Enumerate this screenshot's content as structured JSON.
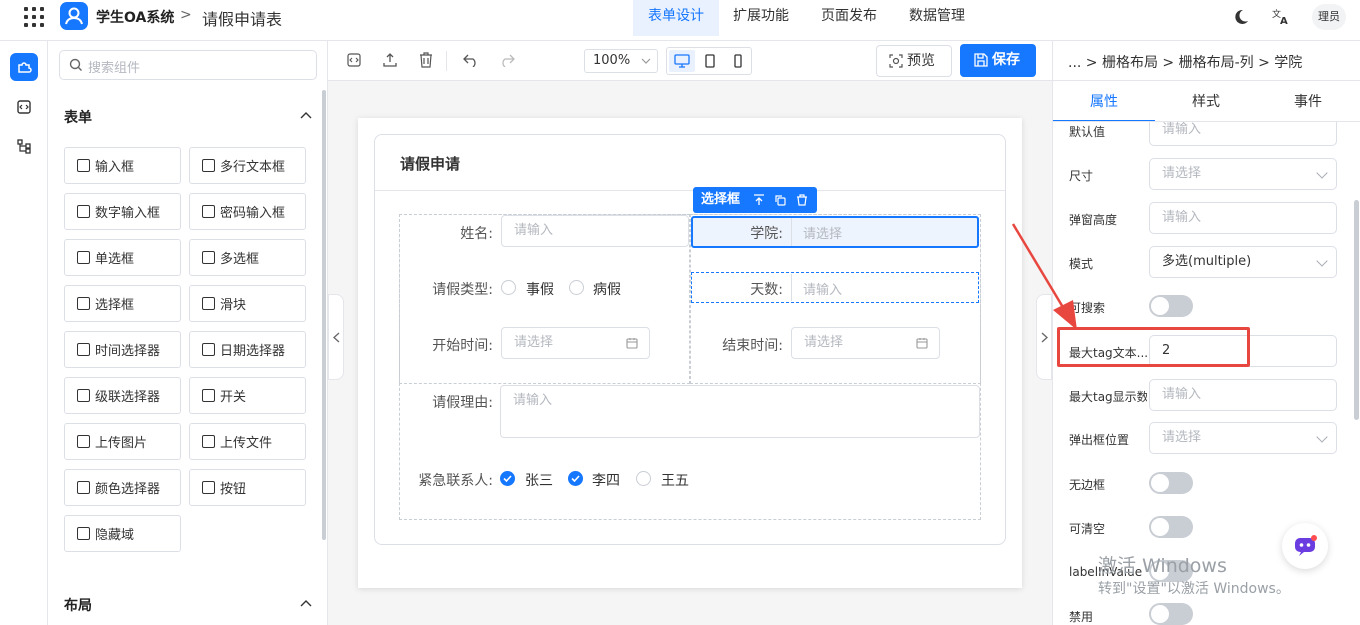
{
  "header": {
    "app_title": "学生OA系统",
    "breadcrumb_sep": ">",
    "page_title": "请假申请表",
    "tabs": [
      {
        "label": "表单设计",
        "active": true
      },
      {
        "label": "扩展功能",
        "active": false
      },
      {
        "label": "页面发布",
        "active": false
      },
      {
        "label": "数据管理",
        "active": false
      }
    ],
    "user_label": "理员"
  },
  "components": {
    "search_placeholder": "搜索组件",
    "section_form": "表单",
    "section_layout": "布局",
    "items": [
      "输入框",
      "多行文本框",
      "数字输入框",
      "密码输入框",
      "单选框",
      "多选框",
      "选择框",
      "滑块",
      "时间选择器",
      "日期选择器",
      "级联选择器",
      "开关",
      "上传图片",
      "上传文件",
      "颜色选择器",
      "按钮",
      "隐藏域"
    ]
  },
  "toolbar": {
    "zoom": "100%",
    "preview": "预览",
    "save": "保存"
  },
  "form": {
    "title": "请假申请",
    "selected_tag": "选择框",
    "name_label": "姓名:",
    "name_placeholder": "请输入",
    "college_label": "学院:",
    "college_placeholder": "请选择",
    "type_label": "请假类型:",
    "type_options": [
      "事假",
      "病假"
    ],
    "days_label": "天数:",
    "days_placeholder": "请输入",
    "start_label": "开始时间:",
    "start_placeholder": "请选择",
    "end_label": "结束时间:",
    "end_placeholder": "请选择",
    "reason_label": "请假理由:",
    "reason_placeholder": "请输入",
    "contact_label": "紧急联系人:",
    "contacts": [
      {
        "name": "张三",
        "checked": true
      },
      {
        "name": "李四",
        "checked": true
      },
      {
        "name": "王五",
        "checked": false
      }
    ]
  },
  "props": {
    "breadcrumb": "... > 栅格布局 > 栅格布局-列 > 学院",
    "tabs": [
      "属性",
      "样式",
      "事件"
    ],
    "default_label": "默认值",
    "default_placeholder": "请输入",
    "size_label": "尺寸",
    "size_placeholder": "请选择",
    "popup_height_label": "弹窗高度",
    "popup_height_placeholder": "请输入",
    "mode_label": "模式",
    "mode_value": "多选(multiple)",
    "searchable_label": "可搜索",
    "max_tag_text_label": "最大tag文本...",
    "max_tag_text_value": "2",
    "max_tag_count_label": "最大tag显示数",
    "max_tag_count_placeholder": "请输入",
    "popup_pos_label": "弹出框位置",
    "popup_pos_placeholder": "请选择",
    "borderless_label": "无边框",
    "clearable_label": "可清空",
    "label_in_value_label": "labelInValue",
    "disabled_label": "禁用"
  },
  "watermark": {
    "line1": "激活 Windows",
    "line2": "转到\"设置\"以激活 Windows。"
  }
}
